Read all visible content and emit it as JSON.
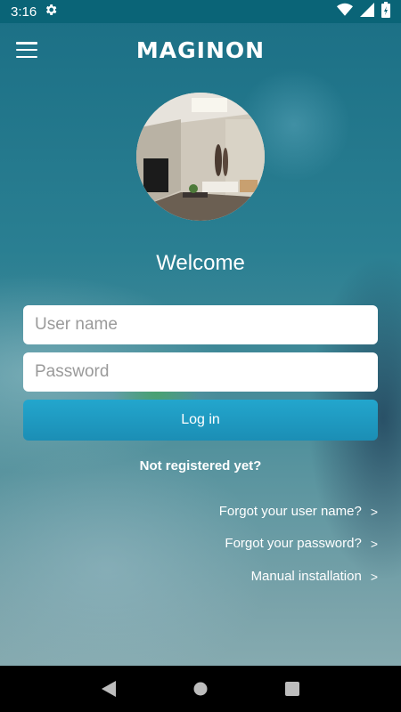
{
  "status_bar": {
    "time": "3:16",
    "icons": [
      "gear-icon",
      "wifi-icon",
      "cell-signal-icon",
      "battery-charging-icon"
    ]
  },
  "app_bar": {
    "logo": "MAGINON",
    "menu_icon": "hamburger-menu-icon"
  },
  "login": {
    "welcome": "Welcome",
    "username_placeholder": "User name",
    "password_placeholder": "Password",
    "login_label": "Log in",
    "register_label": "Not registered yet?"
  },
  "links": [
    {
      "label": "Forgot your user name?",
      "chevron": ">"
    },
    {
      "label": "Forgot your password?",
      "chevron": ">"
    },
    {
      "label": "Manual installation",
      "chevron": ">"
    }
  ],
  "nav_bar": {
    "icons": [
      "back-icon",
      "home-icon",
      "recents-icon"
    ]
  },
  "colors": {
    "status_bar": "#0a6477",
    "login_button": "#1f9dc4",
    "nav_bar": "#000000"
  }
}
